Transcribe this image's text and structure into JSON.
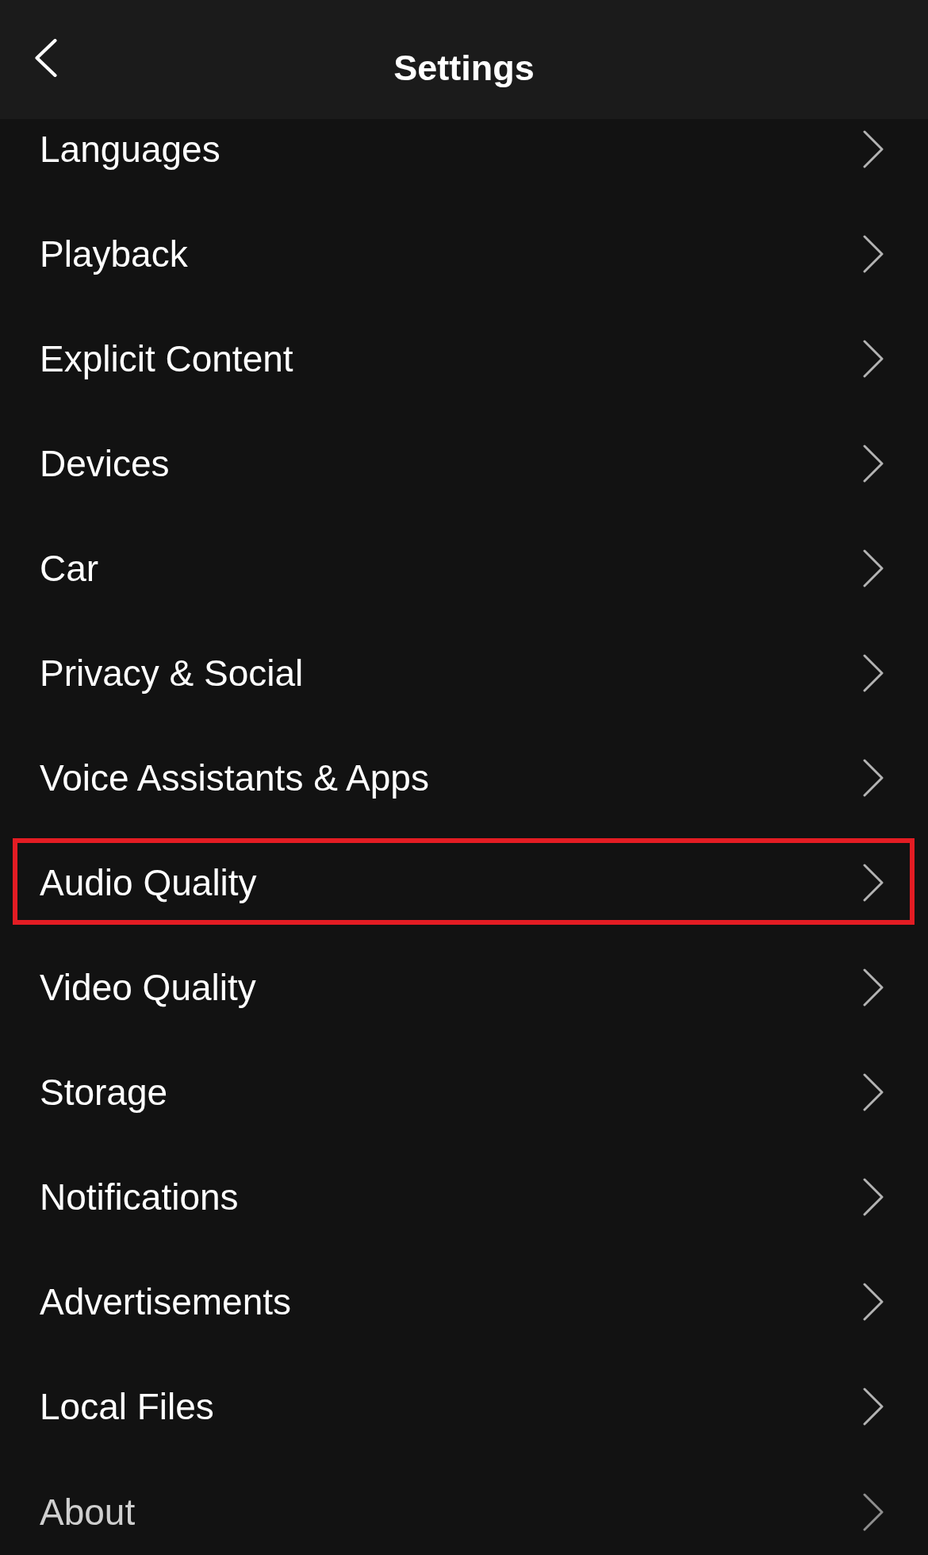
{
  "header": {
    "title": "Settings"
  },
  "items": [
    {
      "label": "Languages",
      "highlighted": false
    },
    {
      "label": "Playback",
      "highlighted": false
    },
    {
      "label": "Explicit Content",
      "highlighted": false
    },
    {
      "label": "Devices",
      "highlighted": false
    },
    {
      "label": "Car",
      "highlighted": false
    },
    {
      "label": "Privacy & Social",
      "highlighted": false
    },
    {
      "label": "Voice Assistants & Apps",
      "highlighted": false
    },
    {
      "label": "Audio Quality",
      "highlighted": true
    },
    {
      "label": "Video Quality",
      "highlighted": false
    },
    {
      "label": "Storage",
      "highlighted": false
    },
    {
      "label": "Notifications",
      "highlighted": false
    },
    {
      "label": "Advertisements",
      "highlighted": false
    },
    {
      "label": "Local Files",
      "highlighted": false
    },
    {
      "label": "About",
      "highlighted": false
    }
  ]
}
